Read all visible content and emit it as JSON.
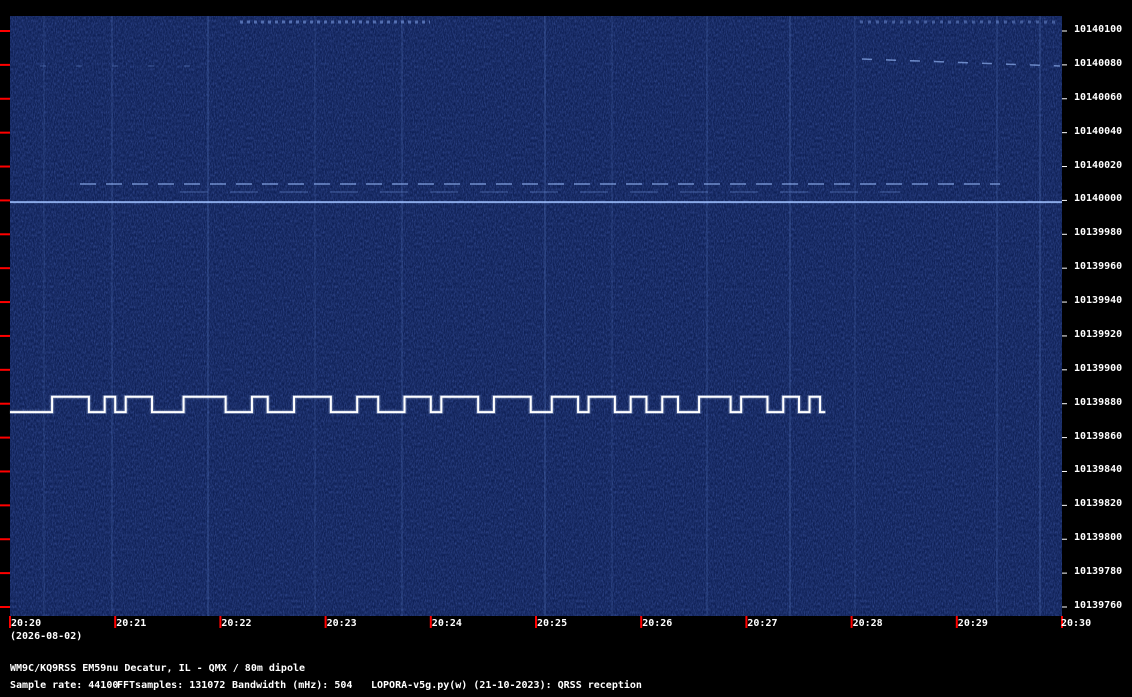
{
  "chart_data": {
    "type": "heatmap",
    "y_ticks": [
      10140100,
      10140080,
      10140060,
      10140040,
      10140020,
      10140000,
      10139980,
      10139960,
      10139940,
      10139920,
      10139900,
      10139880,
      10139860,
      10139840,
      10139820,
      10139800,
      10139780,
      10139760
    ],
    "y_tick_labels": [
      "10140100",
      "10140080",
      "10140060",
      "10140040",
      "10140020",
      "10140000",
      "10139980",
      "10139960",
      "10139940",
      "10139920",
      "10139900",
      "10139880",
      "10139860",
      "10139840",
      "10139820",
      "10139800",
      "10139780",
      "10139760"
    ],
    "ylim": [
      10139755,
      10140110
    ],
    "x_tick_labels": [
      "20:20",
      "20:21",
      "20:22",
      "20:23",
      "20:24",
      "20:25",
      "20:26",
      "20:27",
      "20:28",
      "20:29",
      "20:30"
    ],
    "date_label": "(2026-08-02)",
    "station_line": "WM9C/KQ9RSS EM59nu Decatur, IL - QMX / 80m dipole",
    "sample_rate_label": "Sample rate: 44100",
    "fft_label": "FFTsamples: 131072",
    "bandwidth_label": "Bandwidth (mHz): 504",
    "software_label": "LOPORA-v5g.py(w) (21-10-2023): QRSS reception",
    "carrier_hz": 10139999,
    "qrss_signal": {
      "base_hz": 10139875,
      "high_hz": 10139880,
      "start_min": 0.0,
      "end_min": 7.75,
      "high_segments_min": [
        [
          0.4,
          0.75
        ],
        [
          0.9,
          1.0
        ],
        [
          1.1,
          1.35
        ],
        [
          1.65,
          2.05
        ],
        [
          2.3,
          2.45
        ],
        [
          2.7,
          3.05
        ],
        [
          3.3,
          3.5
        ],
        [
          3.75,
          4.0
        ],
        [
          4.1,
          4.45
        ],
        [
          4.6,
          4.95
        ],
        [
          5.15,
          5.4
        ],
        [
          5.5,
          5.75
        ],
        [
          5.9,
          6.05
        ],
        [
          6.2,
          6.35
        ],
        [
          6.55,
          6.85
        ],
        [
          6.95,
          7.2
        ],
        [
          7.35,
          7.5
        ],
        [
          7.6,
          7.7
        ]
      ]
    },
    "colors": {
      "background": "#0a1a4a",
      "signal": "#ffffff",
      "axis_tick": "#ff0000"
    }
  }
}
